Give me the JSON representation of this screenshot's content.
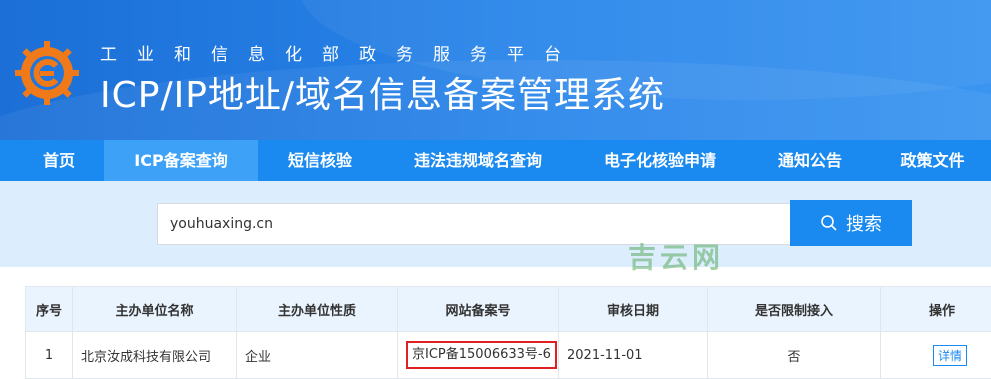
{
  "header": {
    "subtitle": "工业和信息化部政务服务平台",
    "title": "ICP/IP地址/域名信息备案管理系统"
  },
  "nav": {
    "items": [
      "首页",
      "ICP备案查询",
      "短信核验",
      "违法违规域名查询",
      "电子化核验申请",
      "通知公告",
      "政策文件"
    ],
    "active": "ICP备案查询"
  },
  "search": {
    "value": "youhuaxing.cn",
    "button_label": "搜索"
  },
  "watermark": "吉云网",
  "table": {
    "headers": [
      "序号",
      "主办单位名称",
      "主办单位性质",
      "网站备案号",
      "审核日期",
      "是否限制接入",
      "操作"
    ],
    "rows": [
      {
        "index": "1",
        "org_name": "北京汝成科技有限公司",
        "org_type": "企业",
        "icp_number": "京ICP备15006633号-6",
        "review_date": "2021-11-01",
        "restricted": "否",
        "action": "详情"
      }
    ]
  },
  "colors": {
    "header_blue": "#1b6fd6",
    "nav_blue": "#1a8af0",
    "nav_active": "#3da2f7",
    "search_band": "#dceefd",
    "highlight_red": "#e02020"
  }
}
